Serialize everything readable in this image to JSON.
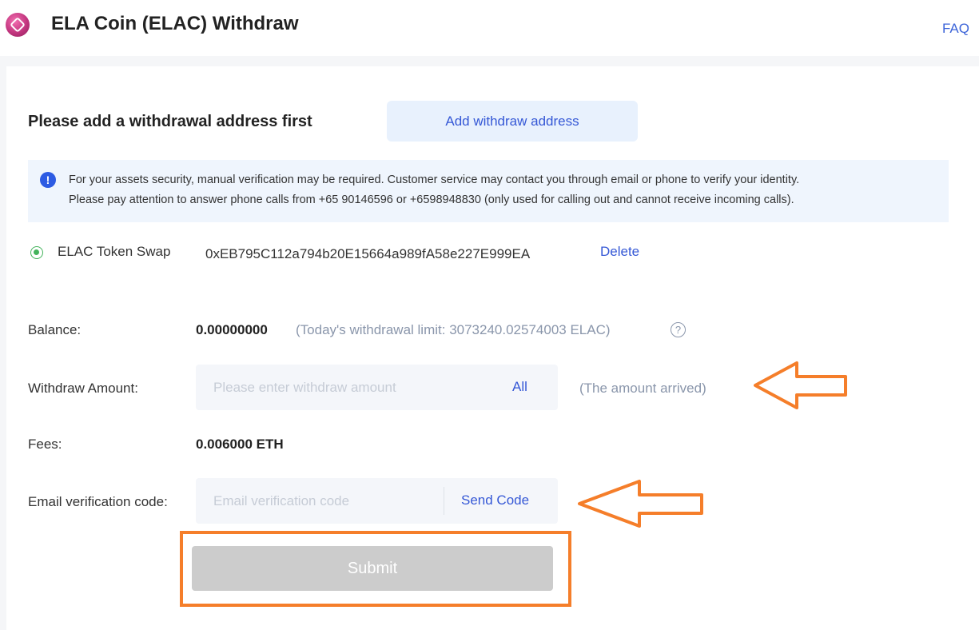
{
  "header": {
    "title": "ELA Coin (ELAC) Withdraw",
    "faq_label": "FAQ",
    "coin_icon": "elac-coin-icon"
  },
  "address_section": {
    "heading": "Please add a withdrawal address first",
    "add_button_label": "Add withdraw address"
  },
  "notice": {
    "icon": "info-icon",
    "icon_glyph": "!",
    "line1": "For your assets security, manual verification may be required. Customer service may contact you through email or phone to verify your identity.",
    "line2": "Please pay attention to answer phone calls from +65 90146596 or +6598948830 (only used for calling out and cannot receive incoming calls)."
  },
  "selected_address": {
    "name": "ELAC Token Swap",
    "address": "0xEB795C112a794b20E15664a989fA58e227E999EA",
    "delete_label": "Delete"
  },
  "form": {
    "balance_label": "Balance:",
    "balance_value": "0.00000000",
    "limit_text": "(Today's withdrawal limit: 3073240.02574003 ELAC)",
    "help_glyph": "?",
    "amount_label": "Withdraw Amount:",
    "amount_placeholder": "Please enter withdraw amount",
    "all_label": "All",
    "arrived_text": "(The amount arrived)",
    "fees_label": "Fees:",
    "fees_value": "0.006000 ETH",
    "code_label": "Email verification code:",
    "code_placeholder": "Email verification code",
    "send_code_label": "Send Code",
    "submit_label": "Submit"
  },
  "colors": {
    "accent": "#3558d6",
    "annotation": "#f57e2a",
    "selected": "#43b35b"
  }
}
